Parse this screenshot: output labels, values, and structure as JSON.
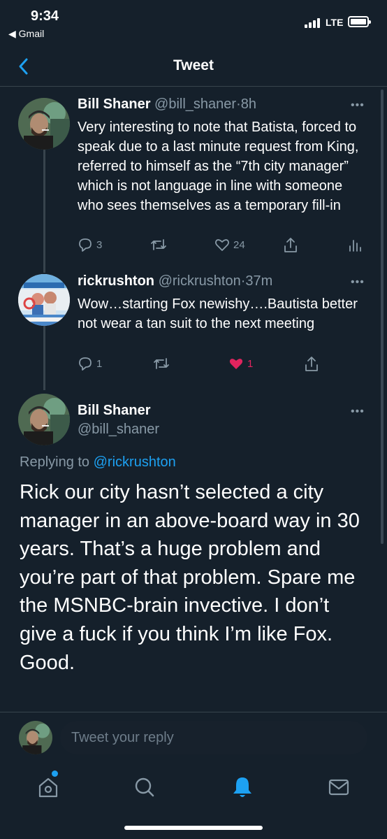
{
  "status_bar": {
    "time": "9:34",
    "back_app": "◀ Gmail",
    "network": "LTE"
  },
  "header": {
    "title": "Tweet"
  },
  "thread": [
    {
      "name": "Bill Shaner",
      "handle": "@bill_shaner",
      "dot": "·",
      "age": "8h",
      "text": "Very interesting to note that Batista, forced to speak due to a last minute request from King, referred to himself as the “7th city manager” which is not language in line with someone who sees themselves as a temporary fill-in",
      "replies": "3",
      "retweets": "",
      "likes": "24"
    },
    {
      "name": "rickrushton",
      "handle": "@rickrushton",
      "dot": "·",
      "age": "37m",
      "text": "Wow…starting Fox newishy….Bautista better not wear a tan suit to the next meeting",
      "replies": "1",
      "retweets": "",
      "likes": "1"
    }
  ],
  "main_tweet": {
    "name": "Bill Shaner",
    "handle": "@bill_shaner",
    "replying_prefix": "Replying to",
    "replying_to": "@rickrushton",
    "text": "Rick our city hasn’t selected a city manager in an above-board way in 30 years. That’s a huge problem and you’re part of that problem. Spare me the MSNBC-brain invective. I don’t give a fuck if you think I’m like Fox. Good."
  },
  "more_icon": "•••",
  "reply_bar": {
    "placeholder": "Tweet your reply"
  },
  "tab_bar": {
    "items": [
      "home-icon",
      "search-icon",
      "notifications-icon",
      "messages-icon"
    ],
    "active": "notifications-icon"
  },
  "colors": {
    "background": "#15202b",
    "accent": "#1da1f2",
    "like": "#e0245e",
    "muted": "#8899a6",
    "divider": "#38444d"
  }
}
